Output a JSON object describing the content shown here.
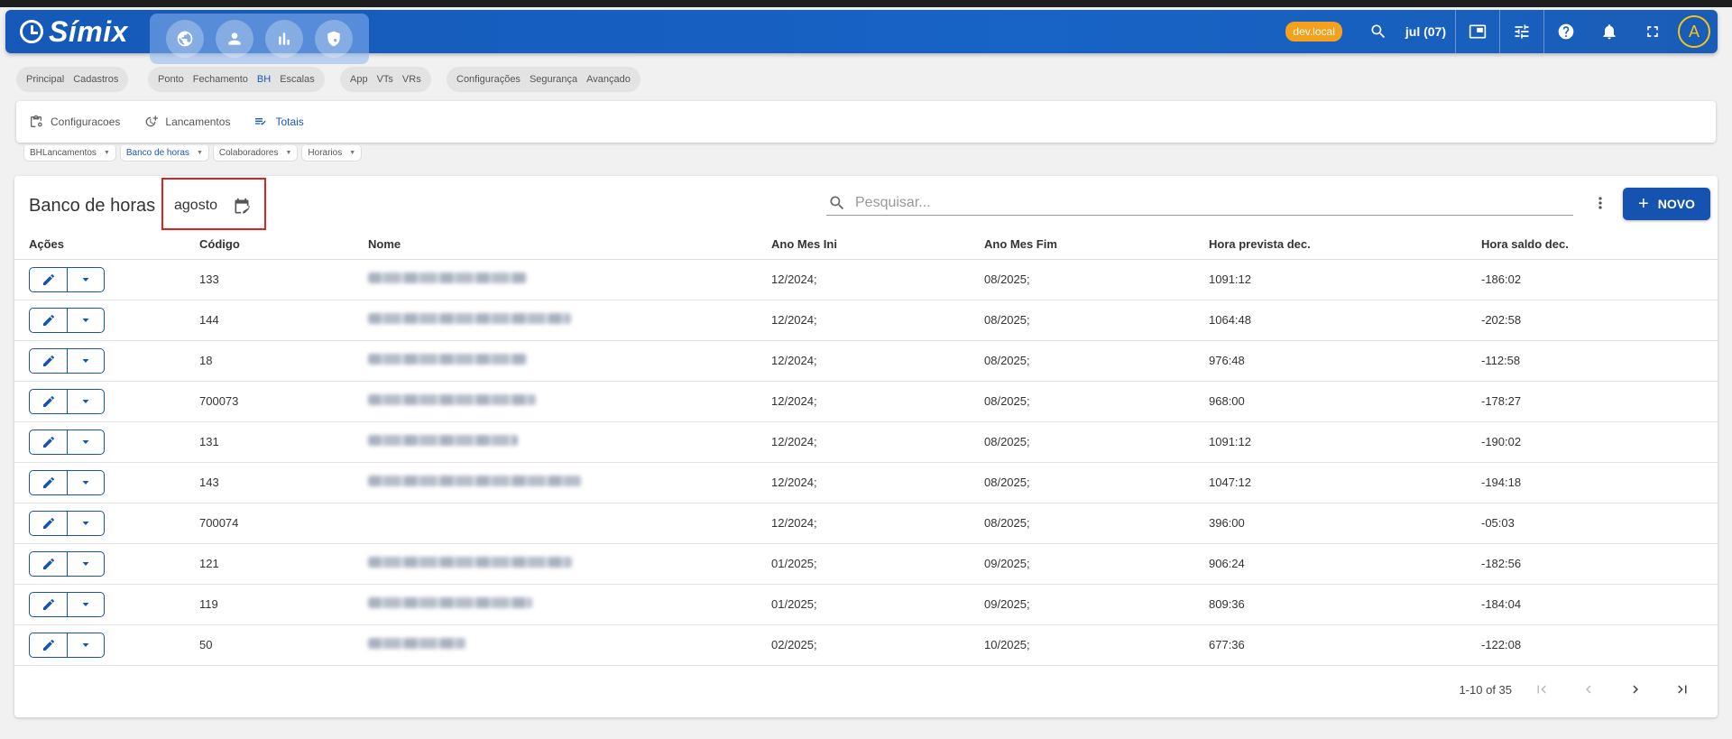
{
  "app": {
    "logo_text": "Símix",
    "env_badge": "dev.local",
    "current_month": "jul (07)",
    "user_initial": "A"
  },
  "module_groups": [
    [
      "Principal",
      "Cadastros"
    ],
    [
      "Ponto",
      "Fechamento",
      "BH",
      "Escalas"
    ],
    [
      "App",
      "VTs",
      "VRs"
    ],
    [
      "Configurações",
      "Segurança",
      "Avançado"
    ]
  ],
  "tabs": [
    {
      "label": "Configuracoes",
      "icon": "clipboard-settings-icon"
    },
    {
      "label": "Lancamentos",
      "icon": "clock-plus-icon"
    },
    {
      "label": "Totais",
      "icon": "list-check-icon",
      "active": true
    }
  ],
  "subtabs": [
    {
      "label": "BHLancamentos"
    },
    {
      "label": "Banco de horas",
      "active": true
    },
    {
      "label": "Colaboradores"
    },
    {
      "label": "Horarios"
    }
  ],
  "page": {
    "title": "Banco de horas",
    "month_value": "agosto",
    "search_placeholder": "Pesquisar...",
    "new_button": "NOVO"
  },
  "table": {
    "headers": [
      "Ações",
      "Código",
      "Nome",
      "Ano Mes Ini",
      "Ano Mes Fim",
      "Hora prevista dec.",
      "Hora saldo dec."
    ],
    "rows": [
      {
        "codigo": "133",
        "ini": "12/2024;",
        "fim": "08/2025;",
        "prevista": "1091:12",
        "saldo": "-186:02"
      },
      {
        "codigo": "144",
        "ini": "12/2024;",
        "fim": "08/2025;",
        "prevista": "1064:48",
        "saldo": "-202:58"
      },
      {
        "codigo": "18",
        "ini": "12/2024;",
        "fim": "08/2025;",
        "prevista": "976:48",
        "saldo": "-112:58"
      },
      {
        "codigo": "700073",
        "ini": "12/2024;",
        "fim": "08/2025;",
        "prevista": "968:00",
        "saldo": "-178:27"
      },
      {
        "codigo": "131",
        "ini": "12/2024;",
        "fim": "08/2025;",
        "prevista": "1091:12",
        "saldo": "-190:02"
      },
      {
        "codigo": "143",
        "ini": "12/2024;",
        "fim": "08/2025;",
        "prevista": "1047:12",
        "saldo": "-194:18"
      },
      {
        "codigo": "700074",
        "ini": "12/2024;",
        "fim": "08/2025;",
        "prevista": "396:00",
        "saldo": "-05:03"
      },
      {
        "codigo": "121",
        "ini": "01/2025;",
        "fim": "09/2025;",
        "prevista": "906:24",
        "saldo": "-182:56"
      },
      {
        "codigo": "119",
        "ini": "01/2025;",
        "fim": "09/2025;",
        "prevista": "809:36",
        "saldo": "-184:04"
      },
      {
        "codigo": "50",
        "ini": "02/2025;",
        "fim": "10/2025;",
        "prevista": "677:36",
        "saldo": "-122:08"
      }
    ]
  },
  "pagination": {
    "range": "1-10 of 35"
  }
}
